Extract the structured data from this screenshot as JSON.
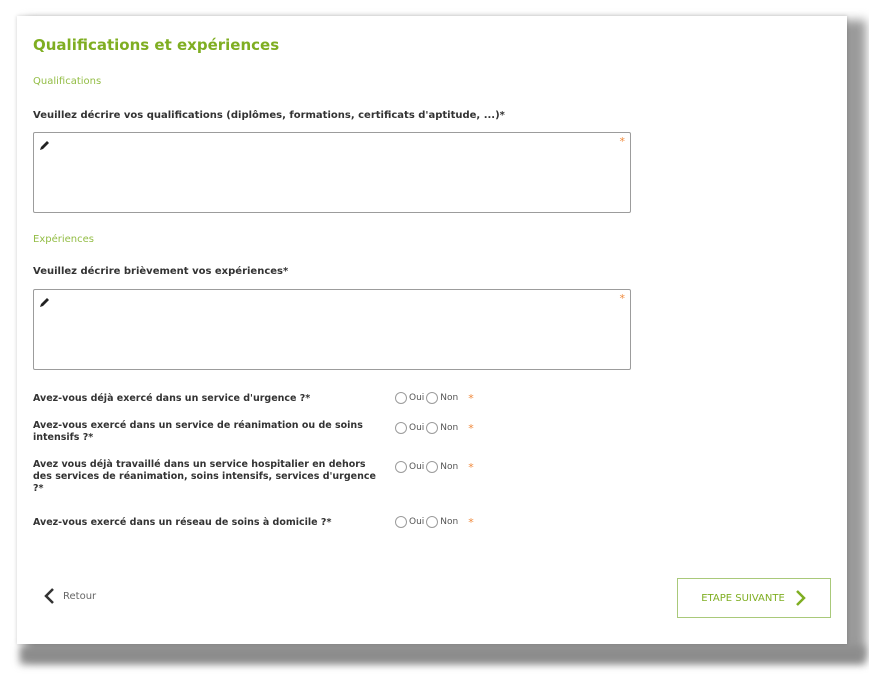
{
  "form": {
    "title": "Qualifications et expériences",
    "qualifications": {
      "heading": "Qualifications",
      "question": "Veuillez décrire vos qualifications (diplômes, formations, certificats d'aptitude, ...)*",
      "required_mark": "*"
    },
    "experiences": {
      "heading": "Expériences",
      "question": "Veuillez décrire brièvement vos expériences*",
      "required_mark": "*"
    },
    "radio_questions": [
      {
        "label": "Avez-vous déjà exercé dans un service d'urgence ?*",
        "yes": "Oui",
        "no": "Non",
        "required_mark": "*"
      },
      {
        "label": "Avez-vous exercé dans un service de réanimation ou de soins intensifs ?*",
        "yes": "Oui",
        "no": "Non",
        "required_mark": "*"
      },
      {
        "label": "Avez vous déjà travaillé dans un service hospitalier en dehors des services de réanimation, soins intensifs, services d'urgence ?*",
        "yes": "Oui",
        "no": "Non",
        "required_mark": "*"
      },
      {
        "label": "Avez-vous exercé dans un réseau de soins à domicile ?*",
        "yes": "Oui",
        "no": "Non",
        "required_mark": "*"
      }
    ],
    "back_label": "Retour",
    "next_label": "ETAPE SUIVANTE"
  },
  "colors": {
    "accent_green": "#7fae22",
    "required_orange": "#f08a3c"
  },
  "icons": {
    "textarea": "pencil-icon",
    "back": "chevron-left-icon",
    "next": "chevron-right-icon"
  }
}
